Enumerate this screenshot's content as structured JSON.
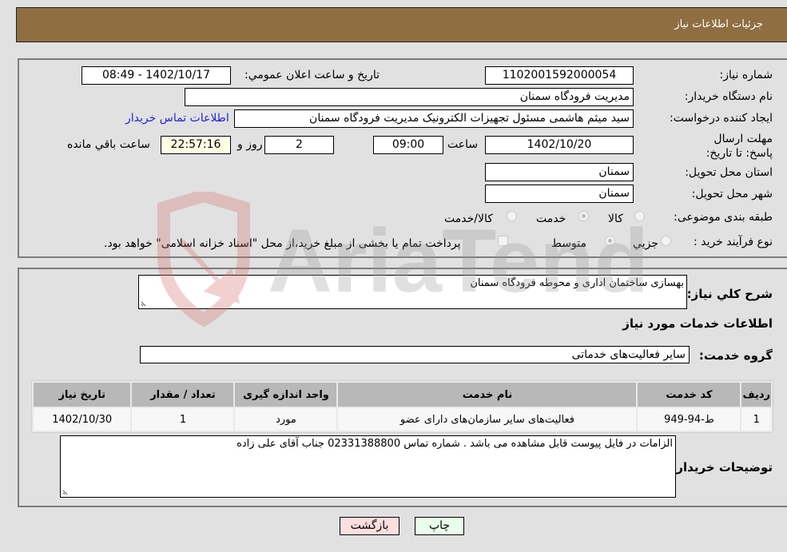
{
  "header": {
    "title": "جزئیات اطلاعات نیاز"
  },
  "fields": {
    "need_number": {
      "label": "شماره نیاز:",
      "value": "1102001592000054"
    },
    "announce_datetime": {
      "label": "تاریخ و ساعت اعلان عمومي:",
      "value": "1402/10/17 - 08:49"
    },
    "buyer_org": {
      "label": "نام دستگاه خریدار:",
      "value": "مدیریت فرودگاه سمنان"
    },
    "requester": {
      "label": "ایجاد کننده درخواست:",
      "value": "سید میثم هاشمی مسئول تجهیزات الکترونیک مدیریت فرودگاه سمنان"
    },
    "buyer_contact_link": "اطلاعات تماس خریدار",
    "deadline": {
      "label": "مهلت ارسال پاسخ: تا تاریخ:",
      "date": "1402/10/20",
      "time_label": "ساعت",
      "time": "09:00",
      "days": "2",
      "days_label": "روز و",
      "remaining": "22:57:16",
      "remaining_label": "ساعت باقي مانده"
    },
    "province": {
      "label": "استان محل تحویل:",
      "value": "سمنان"
    },
    "city": {
      "label": "شهر محل تحویل:",
      "value": "سمنان"
    },
    "category": {
      "label": "طبقه بندی موضوعی:",
      "options": [
        "کالا",
        "خدمت",
        "کالا/خدمت"
      ],
      "selected": "خدمت"
    },
    "purchase_type": {
      "label": "نوع فرآیند خرید :",
      "options": [
        "جزیي",
        "متوسط"
      ],
      "selected": "متوسط",
      "treasury_note": "پرداخت تمام یا بخشی از مبلغ خرید،از محل \"اسناد خزانه اسلامی\" خواهد بود."
    }
  },
  "details": {
    "general_desc_label": "شرح کلي نیاز:",
    "general_desc": "بهسازی ساختمان اداری و محوطه فرودگاه سمنان",
    "services_title": "اطلاعات خدمات مورد نیاز",
    "service_group_label": "گروه خدمت:",
    "service_group": "سایر فعالیت‌های خدماتی",
    "table": {
      "headers": [
        "ردیف",
        "کد خدمت",
        "نام خدمت",
        "واحد اندازه گیری",
        "تعداد / مقدار",
        "تاریخ نیاز"
      ],
      "rows": [
        [
          "1",
          "ط-94-949",
          "فعالیت‌های سایر سازمان‌های دارای عضو",
          "مورد",
          "1",
          "1402/10/30"
        ]
      ]
    },
    "buyer_notes_label": "توضیحات خریدار:",
    "buyer_notes": "الزامات در فایل پیوست قابل مشاهده می باشد . شماره تماس 02331388800 جناب آقای علی زاده"
  },
  "buttons": {
    "print": "چاپ",
    "back": "بازگشت"
  },
  "watermark": {
    "text": "AriaTender.neT"
  },
  "colors": {
    "header_bg": "#8e6e42",
    "link": "#2222dd",
    "print_bg": "#eaffea",
    "back_bg": "#ffdede",
    "timer_bg": "#ffffe6"
  }
}
